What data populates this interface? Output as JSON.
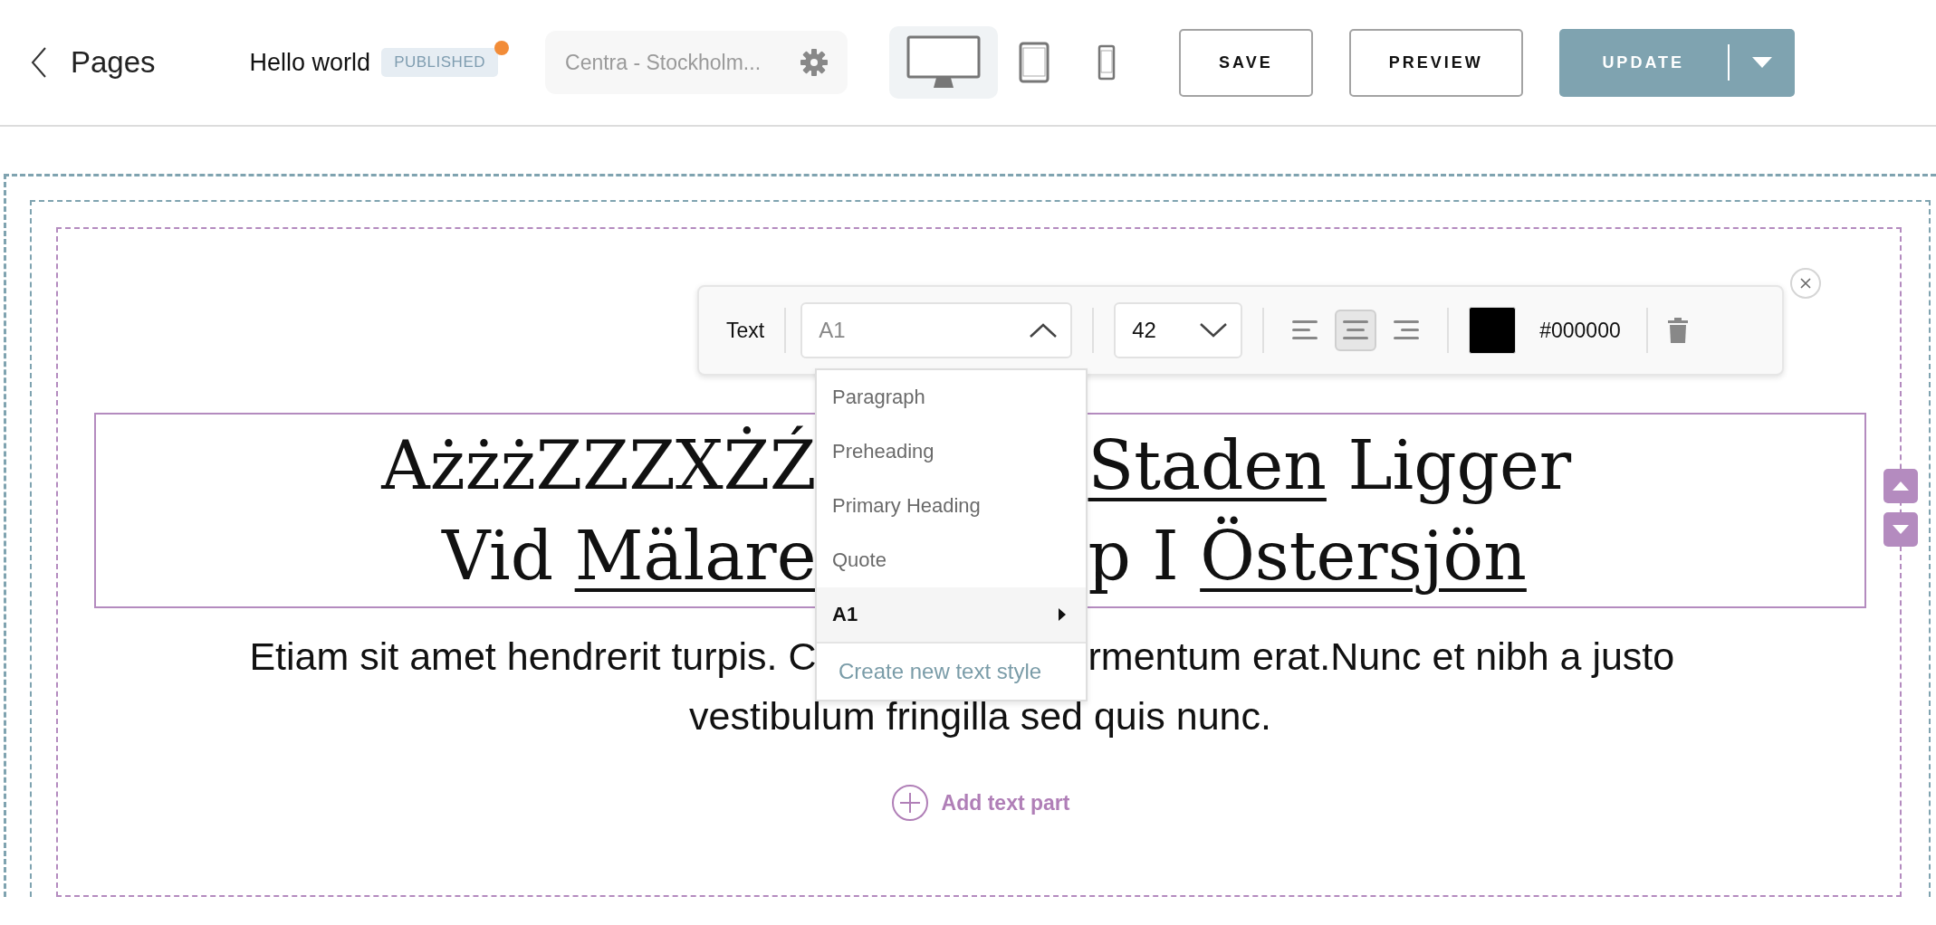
{
  "header": {
    "back_label": "Pages",
    "page_title": "Hello world",
    "status_badge": "PUBLISHED",
    "store_select": {
      "value": "Centra - Stockholm..."
    },
    "devices": [
      {
        "kind": "desktop",
        "selected": true
      },
      {
        "kind": "tablet",
        "selected": false
      },
      {
        "kind": "mobile",
        "selected": false
      }
    ],
    "buttons": [
      {
        "label": "SAVE",
        "kind": "outline"
      },
      {
        "label": "PREVIEW",
        "kind": "outline"
      },
      {
        "label": "UPDATE",
        "kind": "primary"
      }
    ]
  },
  "text_toolbar": {
    "label": "Text",
    "style_select": {
      "value": "A1",
      "expanded": true
    },
    "size_select": {
      "value": "42",
      "expanded": false
    },
    "alignments": [
      {
        "kind": "left",
        "selected": false
      },
      {
        "kind": "center",
        "selected": true
      },
      {
        "kind": "right",
        "selected": false
      }
    ],
    "color_value": "#000000"
  },
  "style_menu": {
    "items": [
      {
        "label": "Paragraph",
        "selected": false,
        "has_submenu": false
      },
      {
        "label": "Preheading",
        "selected": false,
        "has_submenu": false
      },
      {
        "label": "Primary Heading",
        "selected": false,
        "has_submenu": false
      },
      {
        "label": "Quote",
        "selected": false,
        "has_submenu": false
      },
      {
        "label": "A1",
        "selected": true,
        "has_submenu": true
      }
    ],
    "create_link": "Create new text style"
  },
  "headline": {
    "lines": [
      {
        "left": [
          {
            "text": "AżżżZZZXŻŹ",
            "underline": false
          }
        ],
        "right": [
          {
            "text": "Staden",
            "underline": true
          },
          {
            "text": " Ligger",
            "underline": false
          }
        ]
      },
      {
        "left": [
          {
            "text": "Vid ",
            "underline": false
          },
          {
            "text": "Mälare",
            "underline": true
          }
        ],
        "right": [
          {
            "text": "p I ",
            "underline": false
          },
          {
            "text": "Östersjön",
            "underline": true
          }
        ]
      }
    ]
  },
  "body": {
    "lines": [
      {
        "left": "Etiam sit amet hendrerit turpis. C",
        "right": "rmentum erat.Nunc et nibh a justo"
      },
      {
        "text": "vestibulum fringilla sed quis nunc."
      }
    ]
  },
  "add_part": "Add text part"
}
